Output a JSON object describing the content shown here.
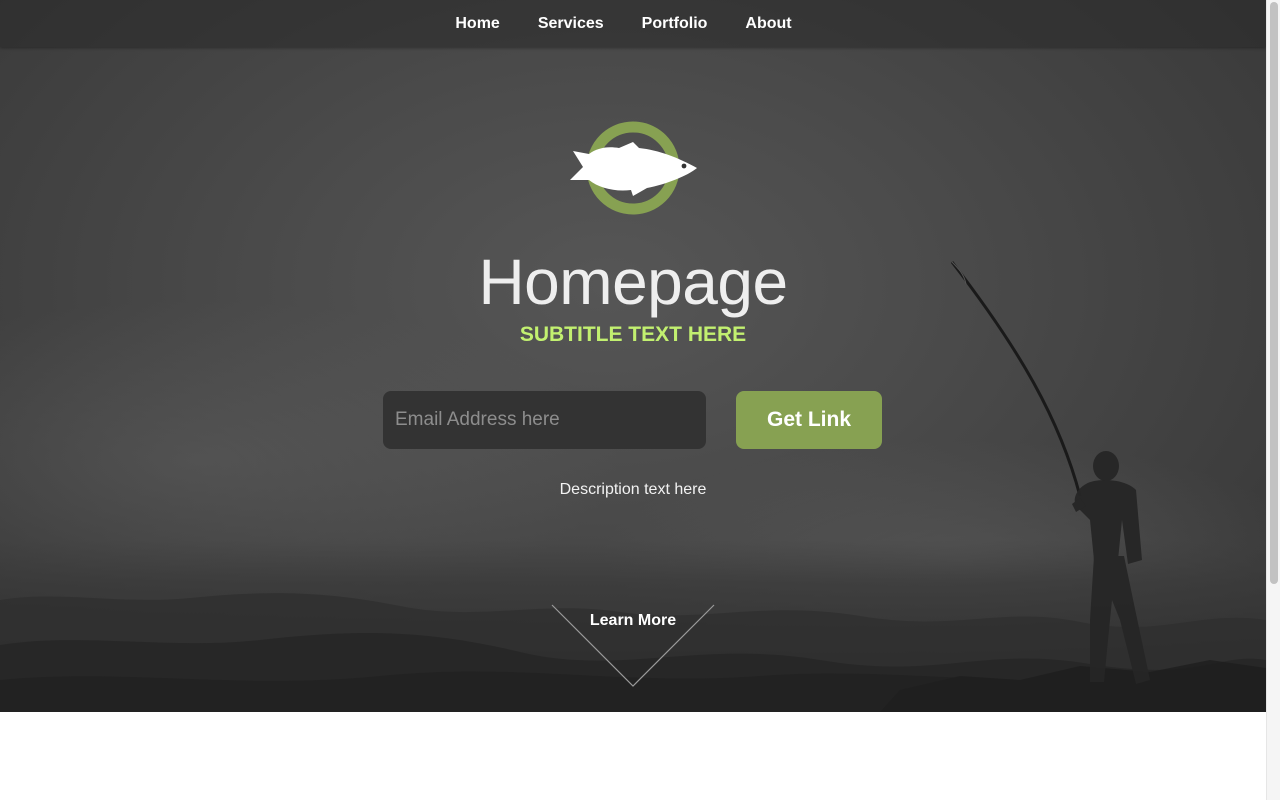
{
  "nav": {
    "items": [
      {
        "label": "Home"
      },
      {
        "label": "Services"
      },
      {
        "label": "Portfolio"
      },
      {
        "label": "About"
      }
    ]
  },
  "hero": {
    "logo_icon": "fish-circle-icon",
    "title": "Homepage",
    "subtitle": "SUBTITLE TEXT HERE",
    "email_placeholder": "Email Address here",
    "email_value": "",
    "cta_label": "Get Link",
    "description": "Description text here",
    "learn_more_label": "Learn More",
    "learn_more_icon": "chevron-down-outline-icon"
  },
  "colors": {
    "accent_green": "#87a152",
    "subtitle_green": "#c2f070",
    "hero_dark": "#444444",
    "input_bg": "#333333"
  }
}
